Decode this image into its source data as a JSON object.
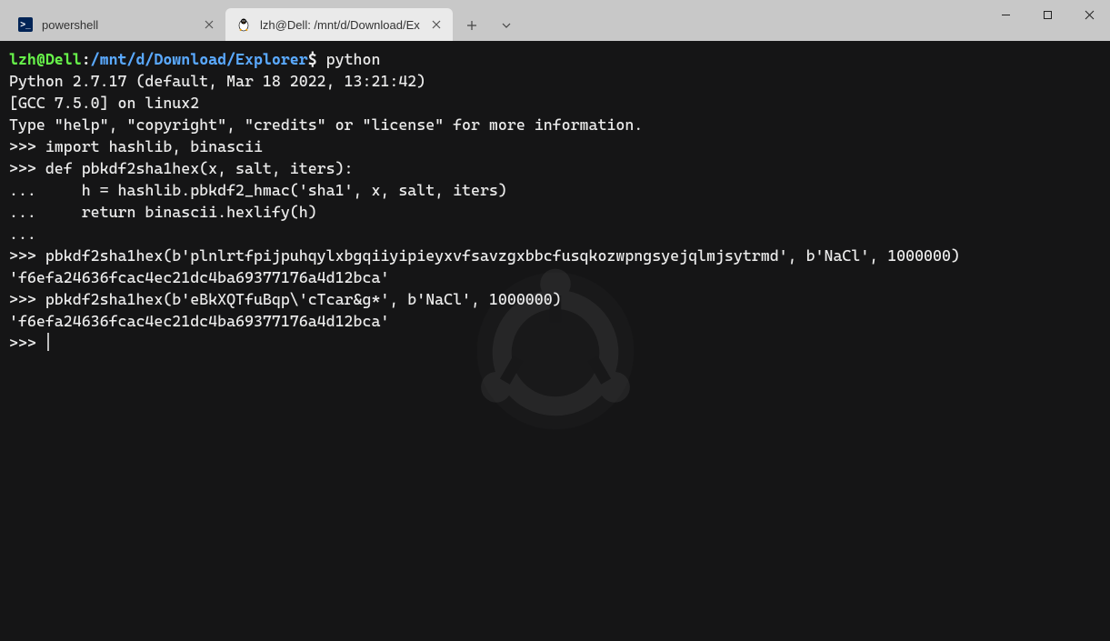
{
  "tabs": [
    {
      "title": "powershell",
      "icon": "powershell-icon",
      "active": false
    },
    {
      "title": "lzh@Dell: /mnt/d/Download/Ex",
      "icon": "linux-icon",
      "active": true
    }
  ],
  "prompt": {
    "user_host": "lzh@Dell",
    "colon": ":",
    "path": "/mnt/d/Download/Explorer",
    "dollar": "$ ",
    "cmd": "python"
  },
  "lines": {
    "l1": "Python 2.7.17 (default, Mar 18 2022, 13:21:42)",
    "l2": "[GCC 7.5.0] on linux2",
    "l3": "Type \"help\", \"copyright\", \"credits\" or \"license\" for more information.",
    "l4": ">>> import hashlib, binascii",
    "l5": ">>> def pbkdf2sha1hex(x, salt, iters):",
    "l6": "...     h = hashlib.pbkdf2_hmac('sha1', x, salt, iters)",
    "l7": "...     return binascii.hexlify(h)",
    "l8": "...",
    "l9": ">>> pbkdf2sha1hex(b'plnlrtfpijpuhqylxbgqiiyipieyxvfsavzgxbbcfusqkozwpngsyejqlmjsytrmd', b'NaCl', 1000000)",
    "l10": "'f6efa24636fcac4ec21dc4ba69377176a4d12bca'",
    "l11": ">>> pbkdf2sha1hex(b'eBkXQTfuBqp\\'cTcar&g*', b'NaCl', 1000000)",
    "l12": "'f6efa24636fcac4ec21dc4ba69377176a4d12bca'",
    "l13": ">>> "
  }
}
